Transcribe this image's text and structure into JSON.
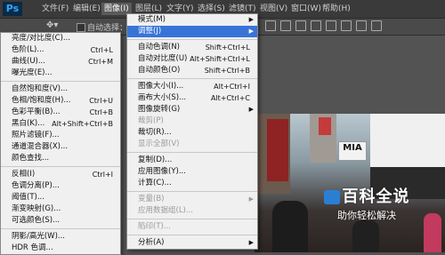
{
  "app": {
    "logo": "Ps"
  },
  "menubar": {
    "items": [
      {
        "label": "文件(F)"
      },
      {
        "label": "编辑(E)"
      },
      {
        "label": "图像(I)"
      },
      {
        "label": "图层(L)"
      },
      {
        "label": "文字(Y)"
      },
      {
        "label": "选择(S)"
      },
      {
        "label": "滤镜(T)"
      },
      {
        "label": "视图(V)"
      },
      {
        "label": "窗口(W)"
      },
      {
        "label": "帮助(H)"
      }
    ]
  },
  "options_bar": {
    "auto_select_label": "自动选择："
  },
  "image_menu": {
    "items": [
      {
        "label": "模式(M)",
        "shortcut": "",
        "submenu": true,
        "disabled": false
      },
      {
        "label": "调整(J)",
        "shortcut": "",
        "submenu": true,
        "disabled": false
      },
      {
        "label": "自动色调(N)",
        "shortcut": "Shift+Ctrl+L",
        "submenu": false,
        "disabled": false
      },
      {
        "label": "自动对比度(U)",
        "shortcut": "Alt+Shift+Ctrl+L",
        "submenu": false,
        "disabled": false
      },
      {
        "label": "自动颜色(O)",
        "shortcut": "Shift+Ctrl+B",
        "submenu": false,
        "disabled": false
      },
      {
        "label": "图像大小(I)...",
        "shortcut": "Alt+Ctrl+I",
        "submenu": false,
        "disabled": false
      },
      {
        "label": "画布大小(S)...",
        "shortcut": "Alt+Ctrl+C",
        "submenu": false,
        "disabled": false
      },
      {
        "label": "图像旋转(G)",
        "shortcut": "",
        "submenu": true,
        "disabled": false
      },
      {
        "label": "裁剪(P)",
        "shortcut": "",
        "submenu": false,
        "disabled": true
      },
      {
        "label": "裁切(R)...",
        "shortcut": "",
        "submenu": false,
        "disabled": false
      },
      {
        "label": "显示全部(V)",
        "shortcut": "",
        "submenu": false,
        "disabled": true
      },
      {
        "label": "复制(D)...",
        "shortcut": "",
        "submenu": false,
        "disabled": false
      },
      {
        "label": "应用图像(Y)...",
        "shortcut": "",
        "submenu": false,
        "disabled": false
      },
      {
        "label": "计算(C)...",
        "shortcut": "",
        "submenu": false,
        "disabled": false
      },
      {
        "label": "变量(B)",
        "shortcut": "",
        "submenu": true,
        "disabled": true
      },
      {
        "label": "应用数据组(L)...",
        "shortcut": "",
        "submenu": false,
        "disabled": true
      },
      {
        "label": "陷印(T)...",
        "shortcut": "",
        "submenu": false,
        "disabled": true
      },
      {
        "label": "分析(A)",
        "shortcut": "",
        "submenu": true,
        "disabled": false
      }
    ]
  },
  "adjust_menu": {
    "items": [
      {
        "label": "亮度/对比度(C)...",
        "shortcut": ""
      },
      {
        "label": "色阶(L)...",
        "shortcut": "Ctrl+L"
      },
      {
        "label": "曲线(U)...",
        "shortcut": "Ctrl+M"
      },
      {
        "label": "曝光度(E)...",
        "shortcut": ""
      },
      {
        "label": "自然饱和度(V)...",
        "shortcut": ""
      },
      {
        "label": "色相/饱和度(H)...",
        "shortcut": "Ctrl+U"
      },
      {
        "label": "色彩平衡(B)...",
        "shortcut": "Ctrl+B"
      },
      {
        "label": "黑白(K)...",
        "shortcut": "Alt+Shift+Ctrl+B"
      },
      {
        "label": "照片滤镜(F)...",
        "shortcut": ""
      },
      {
        "label": "通道混合器(X)...",
        "shortcut": ""
      },
      {
        "label": "颜色查找...",
        "shortcut": ""
      },
      {
        "label": "反相(I)",
        "shortcut": "Ctrl+I"
      },
      {
        "label": "色调分离(P)...",
        "shortcut": ""
      },
      {
        "label": "阈值(T)...",
        "shortcut": ""
      },
      {
        "label": "渐变映射(G)...",
        "shortcut": ""
      },
      {
        "label": "可选颜色(S)...",
        "shortcut": ""
      },
      {
        "label": "阴影/高光(W)...",
        "shortcut": ""
      },
      {
        "label": "HDR 色调...",
        "shortcut": ""
      }
    ]
  },
  "photo": {
    "sign_text": "MIA"
  },
  "watermark": {
    "title": "百科全说",
    "subtitle": "助你轻松解决"
  },
  "colors": {
    "highlight": "#3874d8",
    "menu_bg": "#f0f0f0",
    "app_bg": "#535353"
  }
}
